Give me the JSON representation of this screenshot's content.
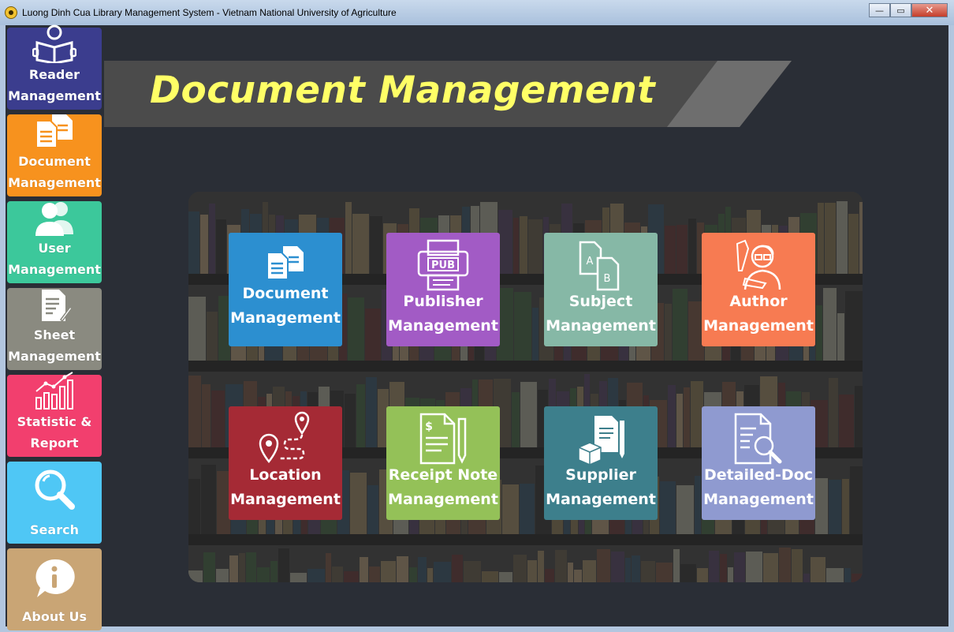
{
  "window": {
    "title": "Luong Dinh Cua Library Management System - Vietnam National University of Agriculture",
    "minimize": "—",
    "maximize": "▭",
    "close": "✕"
  },
  "colors": {
    "background": "#2a2e36",
    "banner": "#4b4b4b",
    "banner_title": "#ffff66"
  },
  "sidebar": {
    "items": [
      {
        "label": "Reader\nManagement",
        "color": "#3b3d8e",
        "icon": "reader-icon"
      },
      {
        "label": "Document\nManagement",
        "color": "#f7921e",
        "icon": "document-icon"
      },
      {
        "label": "User\nManagement",
        "color": "#3cc89b",
        "icon": "users-icon"
      },
      {
        "label": "Sheet\nManagement",
        "color": "#8a8a80",
        "icon": "sheet-icon"
      },
      {
        "label": "Statistic  &\nReport",
        "color": "#f23f6e",
        "icon": "chart-icon"
      },
      {
        "label": "Search",
        "color": "#4fc7f5",
        "icon": "search-icon"
      },
      {
        "label": "About  Us",
        "color": "#c9a575",
        "icon": "info-icon"
      }
    ]
  },
  "banner": {
    "title": "Document Management"
  },
  "tiles": [
    {
      "label": "Document\nManagement",
      "color": "#2c8fd0",
      "icon": "document-icon"
    },
    {
      "label": "Publisher\nManagement",
      "color": "#a25bc5",
      "icon": "publisher-icon"
    },
    {
      "label": "Subject\nManagement",
      "color": "#86b8a6",
      "icon": "subject-icon"
    },
    {
      "label": "Author\nManagement",
      "color": "#f77b52",
      "icon": "author-icon"
    },
    {
      "label": "Location\nManagement",
      "color": "#a52a35",
      "icon": "location-icon"
    },
    {
      "label": "Receipt  Note\nManagement",
      "color": "#94c158",
      "icon": "receipt-icon"
    },
    {
      "label": "Supplier\nManagement",
      "color": "#3d7f8c",
      "icon": "supplier-icon"
    },
    {
      "label": "Detailed-Doc\nManagement",
      "color": "#8f9ad0",
      "icon": "detailed-doc-icon"
    }
  ]
}
